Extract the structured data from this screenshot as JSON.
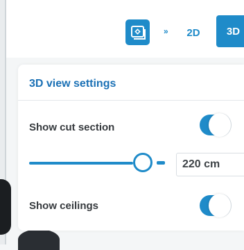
{
  "toolbar": {
    "view_icon": "layers-settings-icon",
    "dropdown_arrow": "»",
    "btn_2d": "2D",
    "btn_3d": "3D"
  },
  "panel": {
    "title": "3D view settings",
    "show_cut_section": {
      "label": "Show cut section",
      "enabled": true
    },
    "cut_height": {
      "value": "220 cm",
      "slider_fraction": 0.8
    },
    "show_ceilings": {
      "label": "Show ceilings",
      "enabled": true
    }
  },
  "colors": {
    "accent": "#1f8bc9",
    "title": "#1a70b5",
    "label": "#35393d"
  }
}
